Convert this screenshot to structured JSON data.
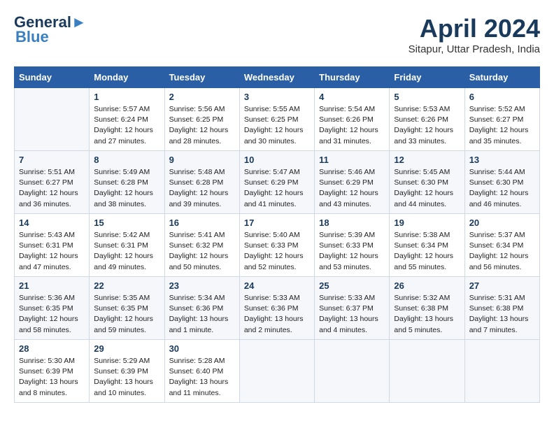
{
  "header": {
    "logo_line1": "General",
    "logo_line2": "Blue",
    "month": "April 2024",
    "location": "Sitapur, Uttar Pradesh, India"
  },
  "weekdays": [
    "Sunday",
    "Monday",
    "Tuesday",
    "Wednesday",
    "Thursday",
    "Friday",
    "Saturday"
  ],
  "weeks": [
    [
      {
        "day": "",
        "info": ""
      },
      {
        "day": "1",
        "info": "Sunrise: 5:57 AM\nSunset: 6:24 PM\nDaylight: 12 hours\nand 27 minutes."
      },
      {
        "day": "2",
        "info": "Sunrise: 5:56 AM\nSunset: 6:25 PM\nDaylight: 12 hours\nand 28 minutes."
      },
      {
        "day": "3",
        "info": "Sunrise: 5:55 AM\nSunset: 6:25 PM\nDaylight: 12 hours\nand 30 minutes."
      },
      {
        "day": "4",
        "info": "Sunrise: 5:54 AM\nSunset: 6:26 PM\nDaylight: 12 hours\nand 31 minutes."
      },
      {
        "day": "5",
        "info": "Sunrise: 5:53 AM\nSunset: 6:26 PM\nDaylight: 12 hours\nand 33 minutes."
      },
      {
        "day": "6",
        "info": "Sunrise: 5:52 AM\nSunset: 6:27 PM\nDaylight: 12 hours\nand 35 minutes."
      }
    ],
    [
      {
        "day": "7",
        "info": "Sunrise: 5:51 AM\nSunset: 6:27 PM\nDaylight: 12 hours\nand 36 minutes."
      },
      {
        "day": "8",
        "info": "Sunrise: 5:49 AM\nSunset: 6:28 PM\nDaylight: 12 hours\nand 38 minutes."
      },
      {
        "day": "9",
        "info": "Sunrise: 5:48 AM\nSunset: 6:28 PM\nDaylight: 12 hours\nand 39 minutes."
      },
      {
        "day": "10",
        "info": "Sunrise: 5:47 AM\nSunset: 6:29 PM\nDaylight: 12 hours\nand 41 minutes."
      },
      {
        "day": "11",
        "info": "Sunrise: 5:46 AM\nSunset: 6:29 PM\nDaylight: 12 hours\nand 43 minutes."
      },
      {
        "day": "12",
        "info": "Sunrise: 5:45 AM\nSunset: 6:30 PM\nDaylight: 12 hours\nand 44 minutes."
      },
      {
        "day": "13",
        "info": "Sunrise: 5:44 AM\nSunset: 6:30 PM\nDaylight: 12 hours\nand 46 minutes."
      }
    ],
    [
      {
        "day": "14",
        "info": "Sunrise: 5:43 AM\nSunset: 6:31 PM\nDaylight: 12 hours\nand 47 minutes."
      },
      {
        "day": "15",
        "info": "Sunrise: 5:42 AM\nSunset: 6:31 PM\nDaylight: 12 hours\nand 49 minutes."
      },
      {
        "day": "16",
        "info": "Sunrise: 5:41 AM\nSunset: 6:32 PM\nDaylight: 12 hours\nand 50 minutes."
      },
      {
        "day": "17",
        "info": "Sunrise: 5:40 AM\nSunset: 6:33 PM\nDaylight: 12 hours\nand 52 minutes."
      },
      {
        "day": "18",
        "info": "Sunrise: 5:39 AM\nSunset: 6:33 PM\nDaylight: 12 hours\nand 53 minutes."
      },
      {
        "day": "19",
        "info": "Sunrise: 5:38 AM\nSunset: 6:34 PM\nDaylight: 12 hours\nand 55 minutes."
      },
      {
        "day": "20",
        "info": "Sunrise: 5:37 AM\nSunset: 6:34 PM\nDaylight: 12 hours\nand 56 minutes."
      }
    ],
    [
      {
        "day": "21",
        "info": "Sunrise: 5:36 AM\nSunset: 6:35 PM\nDaylight: 12 hours\nand 58 minutes."
      },
      {
        "day": "22",
        "info": "Sunrise: 5:35 AM\nSunset: 6:35 PM\nDaylight: 12 hours\nand 59 minutes."
      },
      {
        "day": "23",
        "info": "Sunrise: 5:34 AM\nSunset: 6:36 PM\nDaylight: 13 hours\nand 1 minute."
      },
      {
        "day": "24",
        "info": "Sunrise: 5:33 AM\nSunset: 6:36 PM\nDaylight: 13 hours\nand 2 minutes."
      },
      {
        "day": "25",
        "info": "Sunrise: 5:33 AM\nSunset: 6:37 PM\nDaylight: 13 hours\nand 4 minutes."
      },
      {
        "day": "26",
        "info": "Sunrise: 5:32 AM\nSunset: 6:38 PM\nDaylight: 13 hours\nand 5 minutes."
      },
      {
        "day": "27",
        "info": "Sunrise: 5:31 AM\nSunset: 6:38 PM\nDaylight: 13 hours\nand 7 minutes."
      }
    ],
    [
      {
        "day": "28",
        "info": "Sunrise: 5:30 AM\nSunset: 6:39 PM\nDaylight: 13 hours\nand 8 minutes."
      },
      {
        "day": "29",
        "info": "Sunrise: 5:29 AM\nSunset: 6:39 PM\nDaylight: 13 hours\nand 10 minutes."
      },
      {
        "day": "30",
        "info": "Sunrise: 5:28 AM\nSunset: 6:40 PM\nDaylight: 13 hours\nand 11 minutes."
      },
      {
        "day": "",
        "info": ""
      },
      {
        "day": "",
        "info": ""
      },
      {
        "day": "",
        "info": ""
      },
      {
        "day": "",
        "info": ""
      }
    ]
  ]
}
